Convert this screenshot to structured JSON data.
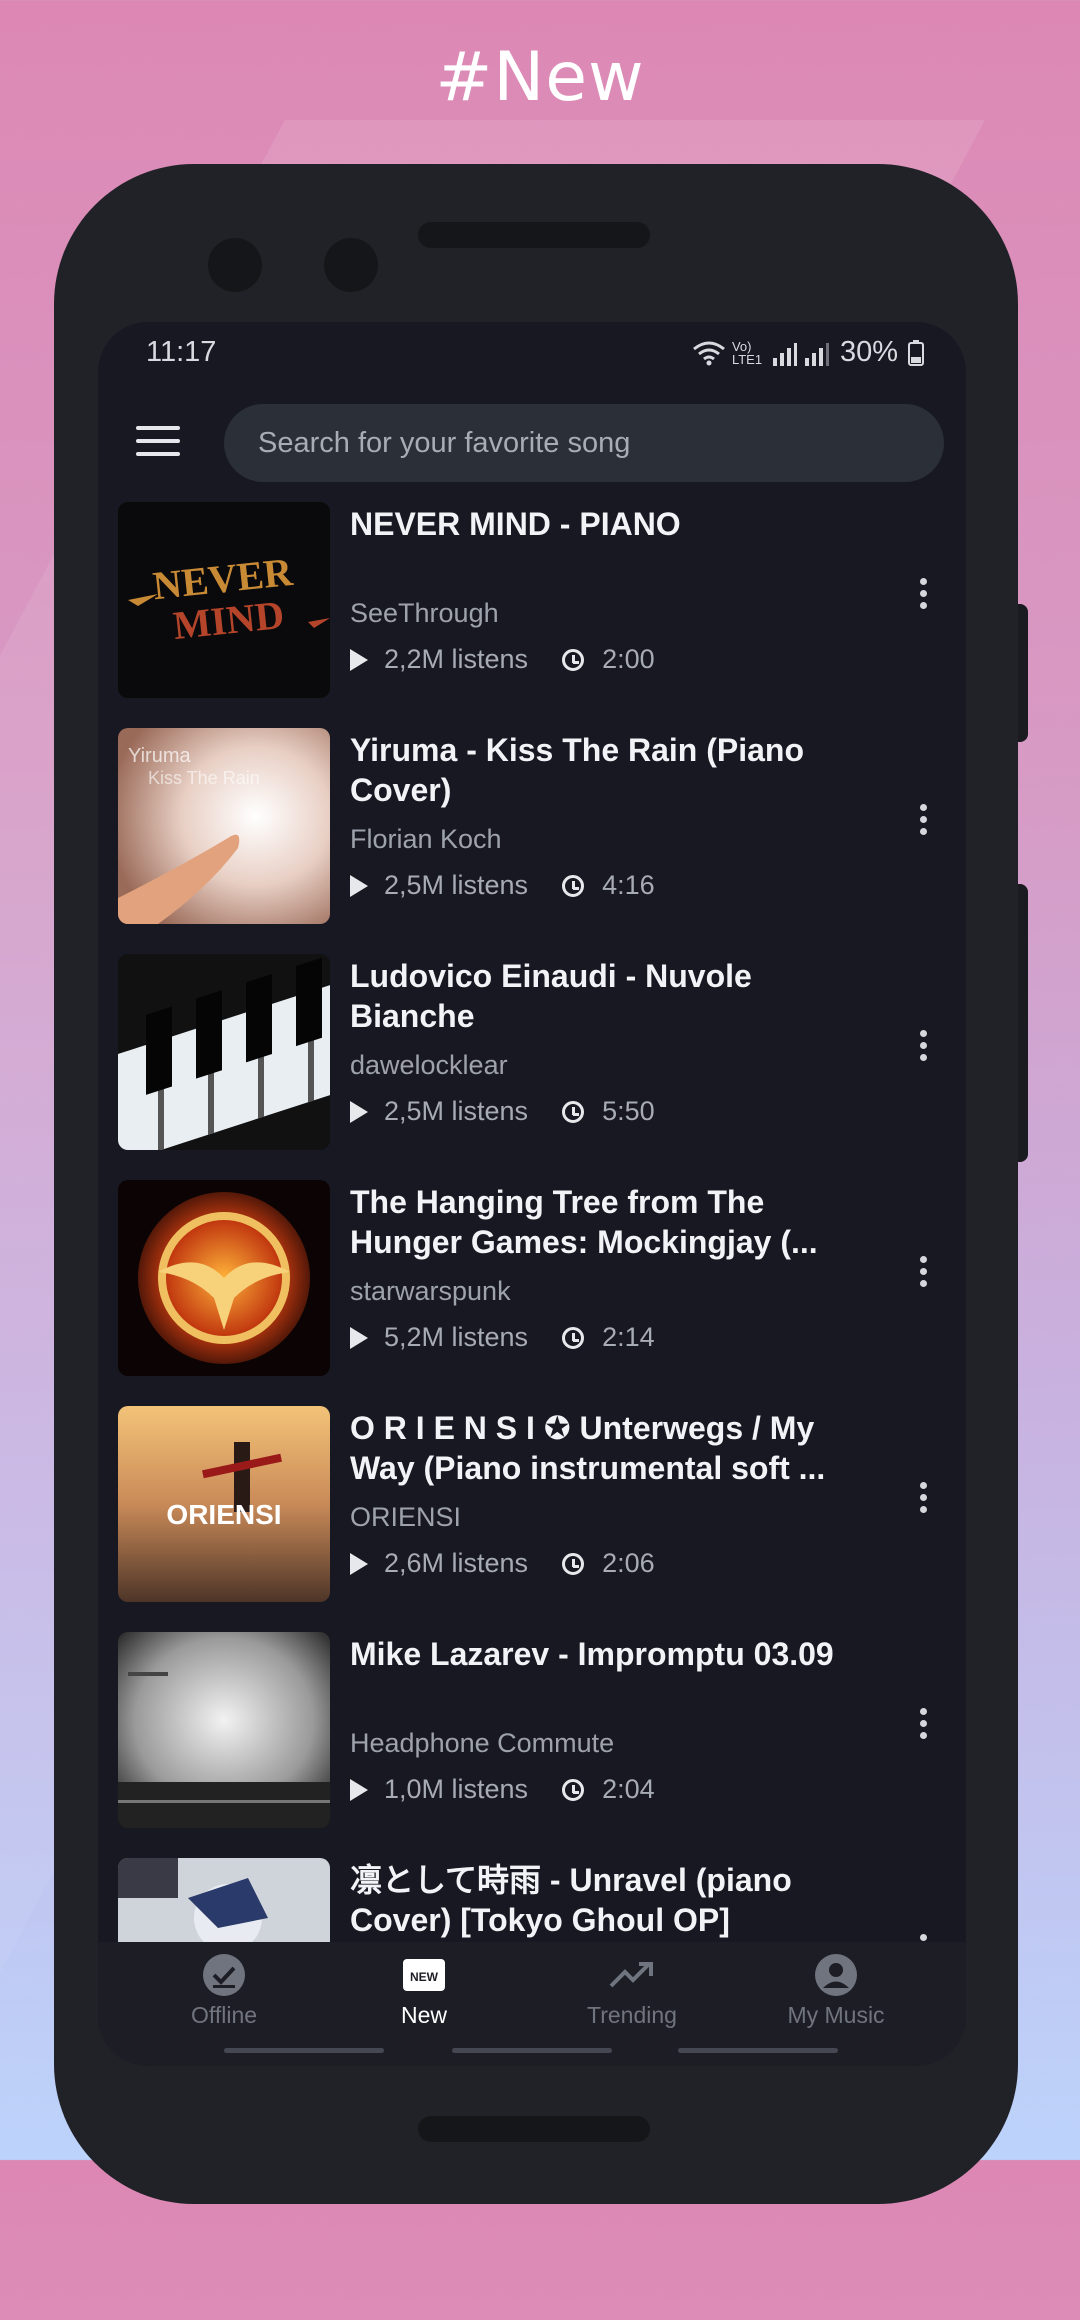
{
  "header": {
    "title": "#New"
  },
  "status_bar": {
    "time": "11:17",
    "network": "Vo) LTE1",
    "battery": "30%"
  },
  "search": {
    "placeholder": "Search for your favorite song"
  },
  "songs": [
    {
      "title": "NEVER MIND - PIANO",
      "artist": "SeeThrough",
      "listens": "2,2M listens",
      "duration": "2:00",
      "thumb_text": "NEVER MIND"
    },
    {
      "title": "Yiruma - Kiss The Rain (Piano Cover)",
      "artist": "Florian Koch",
      "listens": "2,5M listens",
      "duration": "4:16",
      "thumb_text": "Yiruma Kiss The Rain"
    },
    {
      "title": "Ludovico Einaudi - Nuvole Bianche",
      "artist": "dawelocklear",
      "listens": "2,5M listens",
      "duration": "5:50"
    },
    {
      "title": "The Hanging Tree from The Hunger Games: Mockingjay (...",
      "artist": "starwarspunk",
      "listens": "5,2M listens",
      "duration": "2:14"
    },
    {
      "title": "O R I E N S I ✪ Unterwegs / My Way (Piano instrumental soft ...",
      "artist": "ORIENSI",
      "listens": "2,6M listens",
      "duration": "2:06",
      "thumb_text": "ORIENSI"
    },
    {
      "title": "Mike Lazarev - Impromptu 03.09",
      "artist": "Headphone Commute",
      "listens": "1,0M listens",
      "duration": "2:04"
    },
    {
      "title": "凛として時雨 - Unravel (piano Cover) [Tokyo Ghoul OP]",
      "artist": "",
      "listens": "",
      "duration": ""
    }
  ],
  "nav": [
    {
      "label": "Offline",
      "icon": "offline-check-icon",
      "active": false
    },
    {
      "label": "New",
      "icon": "new-badge-icon",
      "active": true,
      "badge": "NEW"
    },
    {
      "label": "Trending",
      "icon": "trending-icon",
      "active": false
    },
    {
      "label": "My Music",
      "icon": "account-circle-icon",
      "active": false
    }
  ],
  "colors": {
    "background": "#171821",
    "accent": "#ffffff",
    "search_bg": "#2b2f37"
  }
}
